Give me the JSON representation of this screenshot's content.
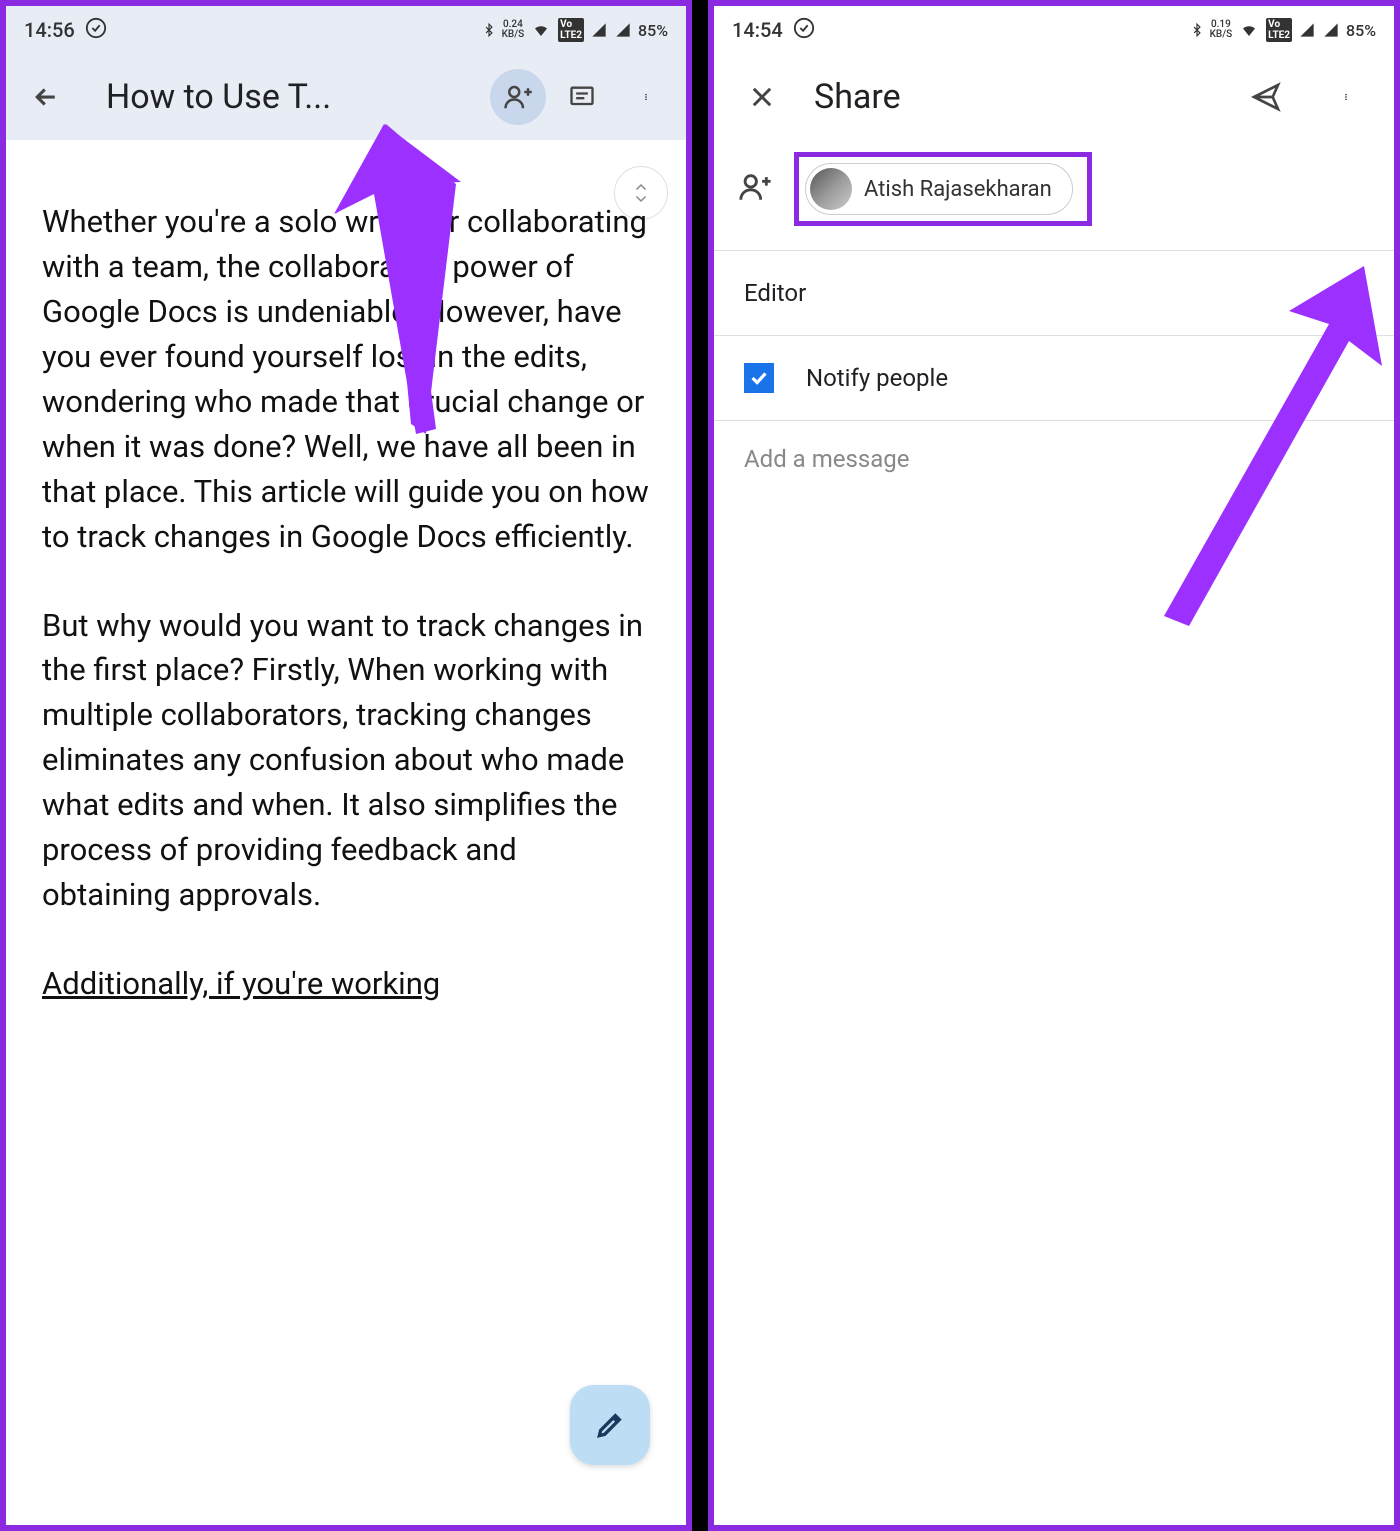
{
  "left": {
    "status": {
      "time": "14:56",
      "net_speed": "0.24",
      "net_unit": "KB/S",
      "battery": "85%"
    },
    "appbar": {
      "title": "How to Use T..."
    },
    "doc": {
      "p1": "Whether you're a solo writer or collaborating with a team, the collaborative power of Google Docs is undeniable. However, have you ever found yourself lost in the edits, wondering who made that crucial change or when it was done? Well, we have all been in that place. This article will guide you on how to track changes in Google Docs efficiently.",
      "p2": "But why would you want to track changes in the first place? Firstly, When working with multiple collaborators, tracking changes eliminates any confusion about who made what edits and when. It also simplifies the process of providing feedback and obtaining approvals.",
      "p3": "Additionally, if you're working"
    }
  },
  "right": {
    "status": {
      "time": "14:54",
      "net_speed": "0.19",
      "net_unit": "KB/S",
      "battery": "85%"
    },
    "appbar": {
      "title": "Share"
    },
    "person": {
      "name": "Atish Rajasekharan"
    },
    "role": {
      "label": "Editor"
    },
    "notify": {
      "label": "Notify people",
      "checked": true
    },
    "message": {
      "placeholder": "Add a message"
    }
  }
}
